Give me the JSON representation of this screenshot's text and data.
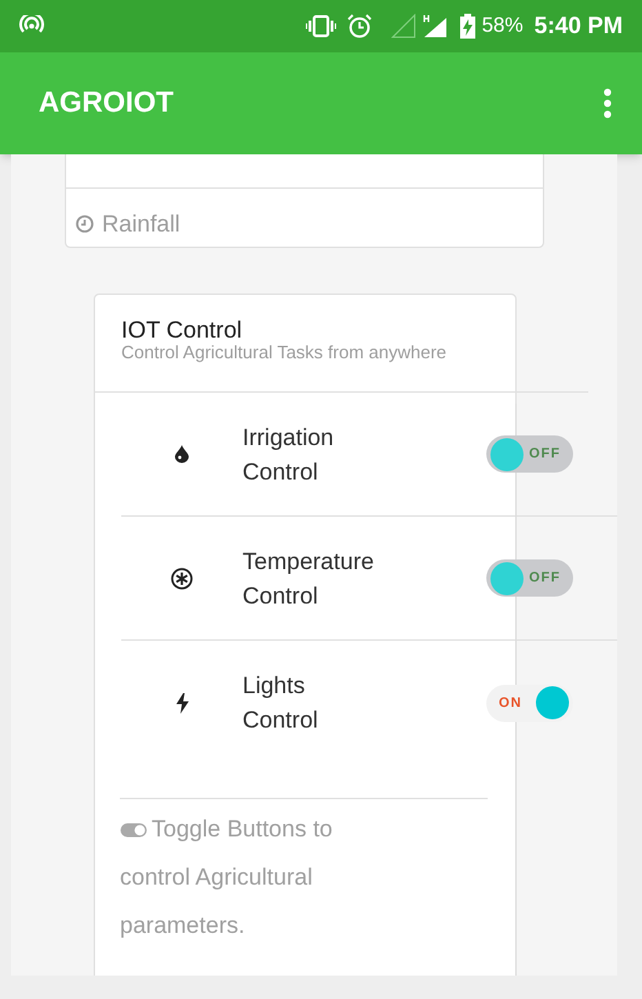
{
  "status_bar": {
    "battery": "58%",
    "time": "5:40 PM"
  },
  "app_bar": {
    "title": "AGROIOT"
  },
  "rainfall_card": {
    "label": "Rainfall"
  },
  "iot_card": {
    "title": "IOT Control",
    "subtitle": "Control Agricultural Tasks from anywhere",
    "controls": [
      {
        "kind": "drop",
        "label": "Irrigation Control",
        "on": false,
        "state_text": "OFF"
      },
      {
        "kind": "snow",
        "label": "Temperature Control",
        "on": false,
        "state_text": "OFF"
      },
      {
        "kind": "bolt",
        "label": "Lights Control",
        "on": true,
        "state_text": "ON"
      }
    ],
    "footer": "Toggle Buttons to control Agricultural parameters."
  }
}
